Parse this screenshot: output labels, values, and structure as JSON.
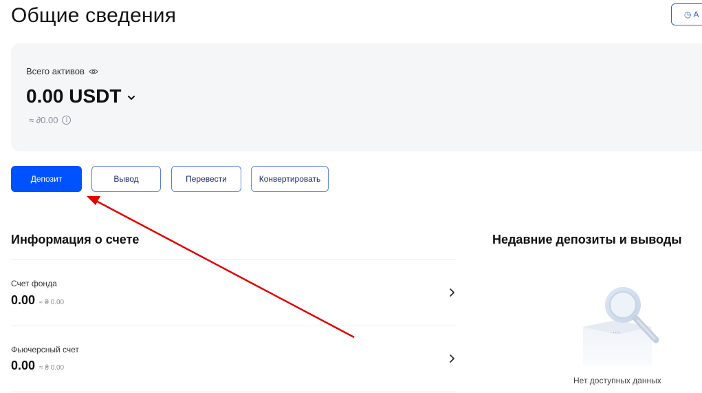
{
  "header": {
    "title": "Общие сведения",
    "top_button_label": "A"
  },
  "assets": {
    "label": "Всего активов",
    "value": "0.00 USDT",
    "approx": "≈ ∂0.00"
  },
  "actions": {
    "deposit": "Депозит",
    "withdraw": "Вывод",
    "transfer": "Перевести",
    "convert": "Конвертировать"
  },
  "account_info": {
    "title": "Информация о счете",
    "accounts": [
      {
        "name": "Счет фонда",
        "value": "0.00",
        "approx": "≈ ₴ 0.00"
      },
      {
        "name": "Фьючерсный счет",
        "value": "0.00",
        "approx": "≈ ₴ 0.00"
      }
    ]
  },
  "recent": {
    "title": "Недавние депозиты и выводы",
    "empty_text": "Нет доступных данных"
  },
  "colors": {
    "primary": "#0052ff",
    "annotation_arrow": "#e60000"
  }
}
